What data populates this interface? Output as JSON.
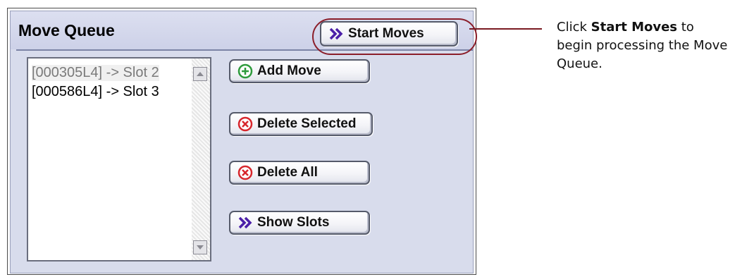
{
  "panel": {
    "title": "Move Queue",
    "start_moves_label": "Start Moves",
    "add_move_label": "Add Move",
    "delete_selected_label": "Delete Selected",
    "delete_all_label": "Delete All",
    "show_slots_label": "Show Slots"
  },
  "move_list": {
    "items": [
      {
        "label": "[000305L4] -> Slot 2",
        "selected": true
      },
      {
        "label": "[000586L4] -> Slot 3",
        "selected": false
      }
    ]
  },
  "callout": {
    "prefix": "Click ",
    "bold": "Start Moves",
    "suffix": " to begin processing the Move Queue."
  },
  "colors": {
    "panel_bg": "#d8dcec",
    "highlight": "#8b1e2a",
    "arrow_icon": "#4b1fa8",
    "add_icon": "#2e9b3c",
    "delete_icon": "#d7262c"
  },
  "icons": {
    "start_moves": "double-chevron-right-icon",
    "add_move": "plus-circle-icon",
    "delete_selected": "x-circle-icon",
    "delete_all": "x-circle-icon",
    "show_slots": "double-chevron-right-icon"
  }
}
